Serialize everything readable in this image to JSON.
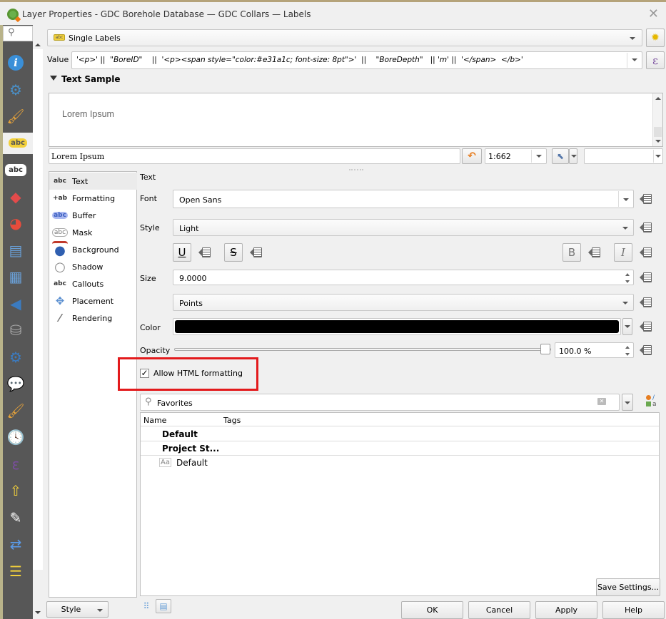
{
  "window": {
    "title": "Layer Properties - GDC Borehole Database — GDC Collars — Labels",
    "close_icon": "close-icon"
  },
  "sidebar": {
    "search_icon": "search-icon",
    "items": [
      {
        "name": "information",
        "icon": "i",
        "color": "#3a8fd8"
      },
      {
        "name": "source",
        "icon": "⚙",
        "color": "#4a90c8"
      },
      {
        "name": "symbology",
        "icon": "🖌",
        "color": "#e7a33a"
      },
      {
        "name": "labels",
        "icon": "abc",
        "color": "#f2d03b",
        "active": true
      },
      {
        "name": "masks",
        "icon": "abc",
        "color": "#ffffff"
      },
      {
        "name": "3d-view",
        "icon": "◆",
        "color": "#e34b4b"
      },
      {
        "name": "diagrams",
        "icon": "◕",
        "color": "#e74c3c"
      },
      {
        "name": "fields",
        "icon": "▤",
        "color": "#6aa0d8"
      },
      {
        "name": "attributes-form",
        "icon": "▦",
        "color": "#6aa0d8"
      },
      {
        "name": "joins",
        "icon": "◀",
        "color": "#3b7bc0"
      },
      {
        "name": "auxiliary-storage",
        "icon": "⛁",
        "color": "#aaaaaa"
      },
      {
        "name": "actions",
        "icon": "⚙",
        "color": "#3b7bc0"
      },
      {
        "name": "display",
        "icon": "💬",
        "color": "#f0e08a"
      },
      {
        "name": "rendering",
        "icon": "🖌",
        "color": "#e7a33a"
      },
      {
        "name": "temporal",
        "icon": "🕓",
        "color": "#ffffff"
      },
      {
        "name": "variables",
        "icon": "ε",
        "color": "#7a4e9e"
      },
      {
        "name": "dependencies",
        "icon": "⇧",
        "color": "#f2d03b"
      },
      {
        "name": "metadata",
        "icon": "✎",
        "color": "#ffffff"
      },
      {
        "name": "qgis-server",
        "icon": "⇄",
        "color": "#5a9ae8"
      },
      {
        "name": "legend",
        "icon": "☰",
        "color": "#f2d03b"
      }
    ]
  },
  "mode_select": {
    "value": "Single Labels"
  },
  "value_field": {
    "label": "Value",
    "expression": "'<p>' ||  \"BoreID\"    ||  '<p><span style=\"color:#e31a1c; font-size: 8pt\">'  ||    \"BoreDepth\"   || 'm' ||  '</span>  </b>'"
  },
  "text_sample": {
    "header": "Text Sample",
    "preview_text": "Lorem Ipsum",
    "input_value": "Lorem Ipsum",
    "scale": "1:662"
  },
  "nav_list": {
    "items": [
      {
        "icon": "abc",
        "label": "Text",
        "selected": true
      },
      {
        "icon": "+ab",
        "label": "Formatting"
      },
      {
        "icon": "abc",
        "label": "Buffer"
      },
      {
        "icon": "abc",
        "label": "Mask"
      },
      {
        "icon": "●",
        "label": "Background"
      },
      {
        "icon": "○",
        "label": "Shadow"
      },
      {
        "icon": "abc",
        "label": "Callouts"
      },
      {
        "icon": "✥",
        "label": "Placement"
      },
      {
        "icon": "⁄",
        "label": "Rendering"
      }
    ]
  },
  "text_panel": {
    "section_title": "Text",
    "font_label": "Font",
    "font_value": "Open Sans",
    "style_label": "Style",
    "style_value": "Light",
    "underline_label": "U",
    "strikeout_label": "S",
    "bold_label": "B",
    "italic_label": "I",
    "size_label": "Size",
    "size_value": "9.0000",
    "unit_value": "Points",
    "color_label": "Color",
    "color_value": "#000000",
    "opacity_label": "Opacity",
    "opacity_value": "100.0 %",
    "opacity_fraction": 1.0,
    "allow_html_label": "Allow HTML formatting",
    "allow_html_checked": true,
    "highlight_color": "#e31a1c"
  },
  "style_manager": {
    "search_placeholder": "Favorites",
    "columns": [
      "Name",
      "Tags"
    ],
    "rows": [
      {
        "name": "Default",
        "bold": true,
        "indent": 1
      },
      {
        "name": "Project St...",
        "bold": true,
        "indent": 1
      },
      {
        "name": "Default",
        "bold": false,
        "icon": "Aa",
        "indent": 2
      }
    ],
    "save_settings_label": "Save Settings..."
  },
  "footer": {
    "style_label": "Style",
    "ok_label": "OK",
    "cancel_label": "Cancel",
    "apply_label": "Apply",
    "help_label": "Help"
  }
}
